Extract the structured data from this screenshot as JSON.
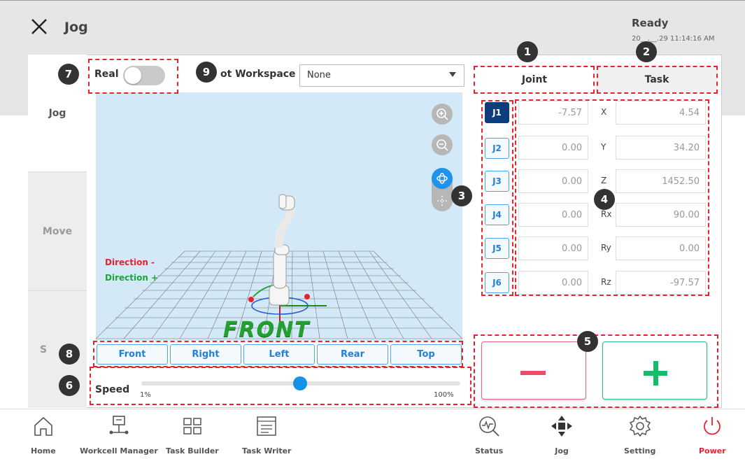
{
  "header": {
    "title": "Jog",
    "status": "Ready",
    "datetime": "20__.__.29 11:14:16 AM"
  },
  "sidebar": {
    "items": [
      {
        "label": "Jog"
      },
      {
        "label": "Move"
      },
      {
        "label": "S"
      }
    ]
  },
  "controls": {
    "real_label": "Real",
    "real_on": false,
    "workspace_label": "ot Workspace",
    "workspace_value": "None"
  },
  "view": {
    "direction_minus": "Direction -",
    "direction_plus": "Direction +",
    "floor_label": "FRONT",
    "buttons": [
      "Front",
      "Right",
      "Left",
      "Rear",
      "Top"
    ]
  },
  "speed": {
    "label": "Speed",
    "min": "1%",
    "max": "100%",
    "value_percent": 50
  },
  "tabs": {
    "joint": "Joint",
    "task": "Task"
  },
  "joints": [
    {
      "name": "J1",
      "value": "-7.57"
    },
    {
      "name": "J2",
      "value": "0.00"
    },
    {
      "name": "J3",
      "value": "0.00"
    },
    {
      "name": "J4",
      "value": "0.00"
    },
    {
      "name": "J5",
      "value": "0.00"
    },
    {
      "name": "J6",
      "value": "0.00"
    }
  ],
  "task": [
    {
      "label": "X",
      "value": "4.54"
    },
    {
      "label": "Y",
      "value": "34.20"
    },
    {
      "label": "Z",
      "value": "1452.50"
    },
    {
      "label": "Rx",
      "value": "90.00"
    },
    {
      "label": "Ry",
      "value": "0.00"
    },
    {
      "label": "Rz",
      "value": "-97.57"
    }
  ],
  "badges": [
    "1",
    "2",
    "3",
    "4",
    "5",
    "6",
    "7",
    "8",
    "9"
  ],
  "nav": [
    {
      "label": "Home",
      "icon": "home-icon"
    },
    {
      "label": "Workcell Manager",
      "icon": "workcell-icon"
    },
    {
      "label": "Task Builder",
      "icon": "task-builder-icon"
    },
    {
      "label": "Task Writer",
      "icon": "task-writer-icon"
    },
    {
      "label": "Status",
      "icon": "status-icon"
    },
    {
      "label": "Jog",
      "icon": "jog-icon"
    },
    {
      "label": "Setting",
      "icon": "gear-icon"
    },
    {
      "label": "Power",
      "icon": "power-icon"
    }
  ],
  "colors": {
    "accent": "#2181d6",
    "selected_joint": "#0e3d7e",
    "annotation": "#e8232f",
    "minus": "#ee4d6a",
    "plus": "#1bb96c",
    "power": "#e8232f"
  }
}
